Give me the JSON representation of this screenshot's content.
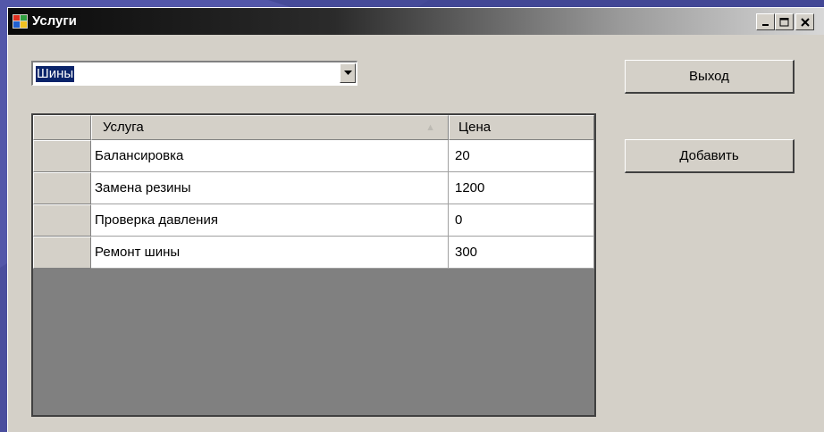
{
  "window": {
    "title": "Услуги",
    "colors": {
      "titlebar_start": "#0a0a0a",
      "titlebar_end": "#d8d8d8",
      "face": "#d4d0c8",
      "selection": "#0a246a",
      "grid_empty": "#808080"
    }
  },
  "category_combo": {
    "value": "Шины"
  },
  "grid": {
    "columns": {
      "service": "Услуга",
      "price": "Цена"
    },
    "sort_indicator": "▲",
    "rows": [
      {
        "service": "Балансировка",
        "price": "20"
      },
      {
        "service": "Замена резины",
        "price": "1200"
      },
      {
        "service": "Проверка давления",
        "price": "0"
      },
      {
        "service": "Ремонт шины",
        "price": "300"
      }
    ]
  },
  "buttons": {
    "exit": "Выход",
    "add": "Добавить"
  },
  "icons": {
    "app": "app-window-icon",
    "minimize": "minimize-icon",
    "maximize": "maximize-icon",
    "close": "close-icon",
    "dropdown": "chevron-down-icon"
  }
}
